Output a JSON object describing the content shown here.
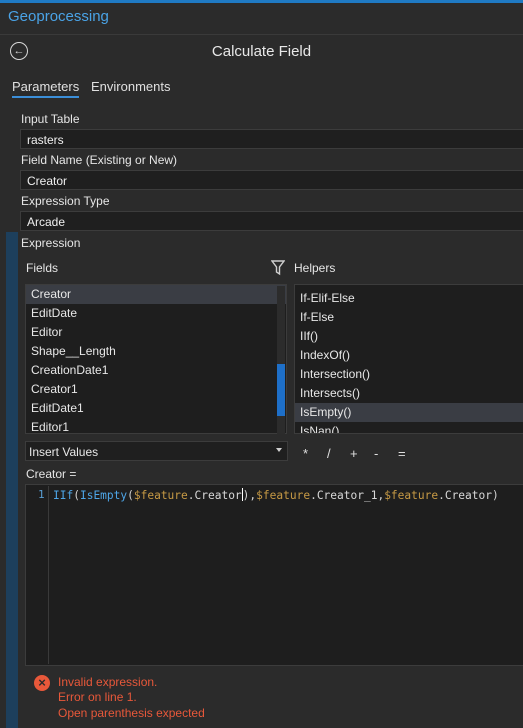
{
  "pane": {
    "title": "Geoprocessing"
  },
  "tool": {
    "title": "Calculate Field"
  },
  "tabs": [
    {
      "label": "Parameters",
      "active": true
    },
    {
      "label": "Environments",
      "active": false
    }
  ],
  "params": {
    "input_table": {
      "label": "Input Table",
      "value": "rasters"
    },
    "field_name": {
      "label": "Field Name (Existing or New)",
      "value": "Creator"
    },
    "expression_type": {
      "label": "Expression Type",
      "value": "Arcade"
    },
    "expression_label": "Expression"
  },
  "fields": {
    "label": "Fields",
    "items": [
      "Creator",
      "EditDate",
      "Editor",
      "Shape__Length",
      "CreationDate1",
      "Creator1",
      "EditDate1",
      "Editor1"
    ],
    "selected": "Creator"
  },
  "helpers": {
    "label": "Helpers",
    "items": [
      "If-Elif-Else",
      "If-Else",
      "IIf()",
      "IndexOf()",
      "Intersection()",
      "Intersects()",
      "IsEmpty()",
      "IsNan()"
    ],
    "selected": "IsEmpty()"
  },
  "insert": {
    "value": "Insert Values"
  },
  "operators": [
    "*",
    "/",
    "+",
    "-",
    "="
  ],
  "expression": {
    "target_label": "Creator =",
    "line_number": "1",
    "code": "IIf(IsEmpty($feature.Creator),$feature.Creator_1,$feature.Creator)",
    "tokens": {
      "iif": "IIf",
      "isempty": "IsEmpty",
      "open": "(",
      "feature": "$feature",
      "dot": ".",
      "creator": "Creator",
      "close": ")",
      "comma": ",",
      "creator_1": "Creator_1"
    }
  },
  "error": {
    "line1": "Invalid expression.",
    "line2": "Error on line 1.",
    "line3": "Open parenthesis expected"
  },
  "colors": {
    "accent": "#1f7ac4",
    "error": "#e8583a",
    "code_function": "#4ea6e8",
    "code_variable": "#c79a45"
  }
}
